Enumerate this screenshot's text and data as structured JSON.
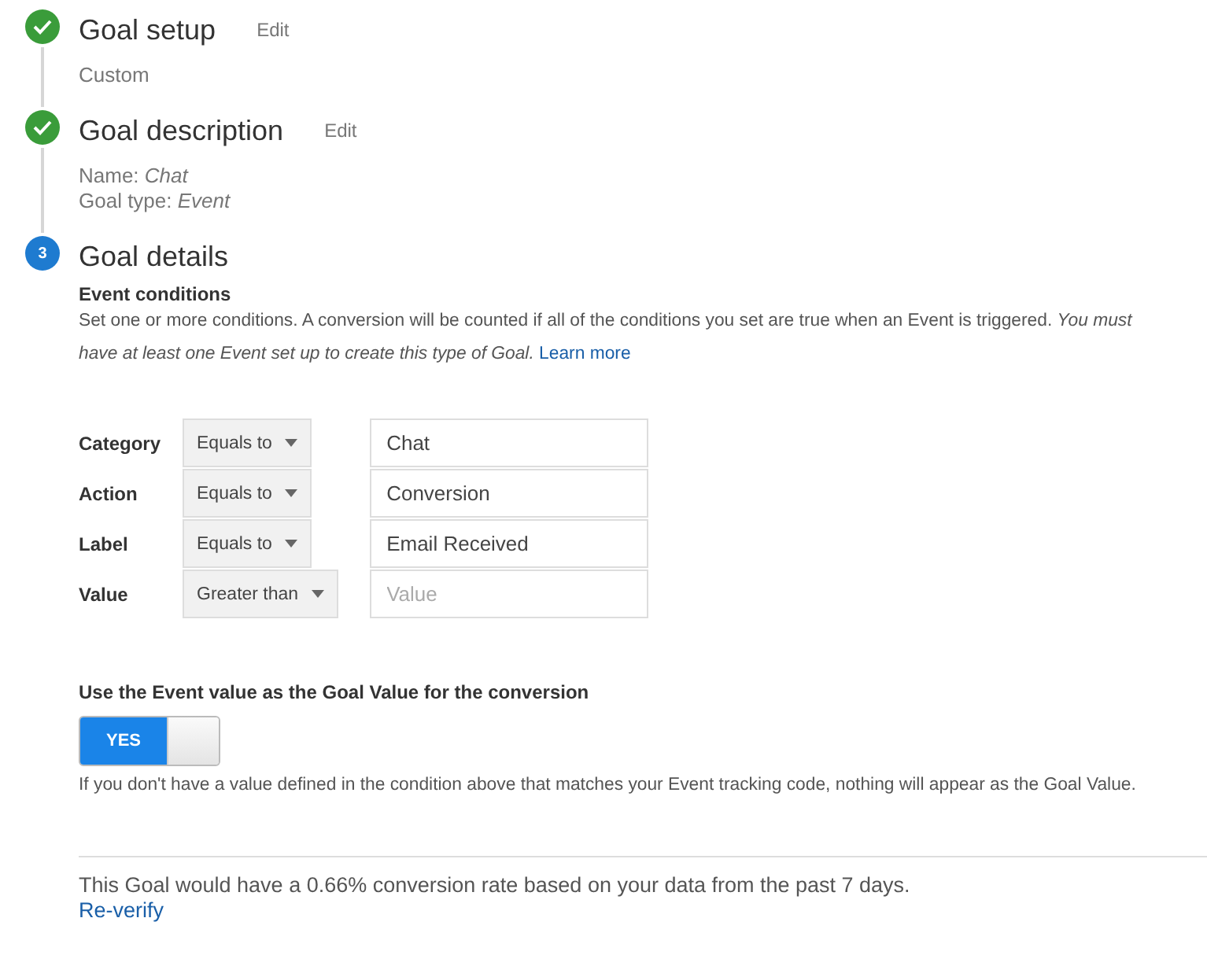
{
  "steps": [
    {
      "kind": "done",
      "title": "Goal setup",
      "edit": "Edit",
      "lines": [
        "Custom"
      ]
    },
    {
      "kind": "done",
      "title": "Goal description",
      "edit": "Edit",
      "lines": [
        "Name: *Chat*",
        "Goal type: *Event*"
      ]
    },
    {
      "kind": "current",
      "number": "3",
      "title": "Goal details"
    }
  ],
  "event_conditions": {
    "heading": "Event conditions",
    "description": "Set one or more conditions. A conversion will be counted if all of the conditions you set are true when an Event is triggered. *You must have at least one Event set up to create this type of Goal.*",
    "link": "Learn more",
    "rows": [
      {
        "label": "Category",
        "operator": "Equals to",
        "value": "Chat"
      },
      {
        "label": "Action",
        "operator": "Equals to",
        "value": "Conversion"
      },
      {
        "label": "Label",
        "operator": "Equals to",
        "value": "Email Received"
      },
      {
        "label": "Value",
        "operator": "Greater than",
        "placeholder": "Value"
      }
    ]
  },
  "goal_value": {
    "heading": "Use the Event value as the Goal Value for the conversion",
    "toggle": {
      "label": "YES",
      "on": true
    },
    "note": "If you don't have a value defined in the condition above that matches your Event tracking code, nothing will appear as the Goal Value."
  },
  "verify": {
    "text": "This Goal would have a 0.66% conversion rate based on your data from the past 7 days.",
    "link": "Re-verify"
  }
}
